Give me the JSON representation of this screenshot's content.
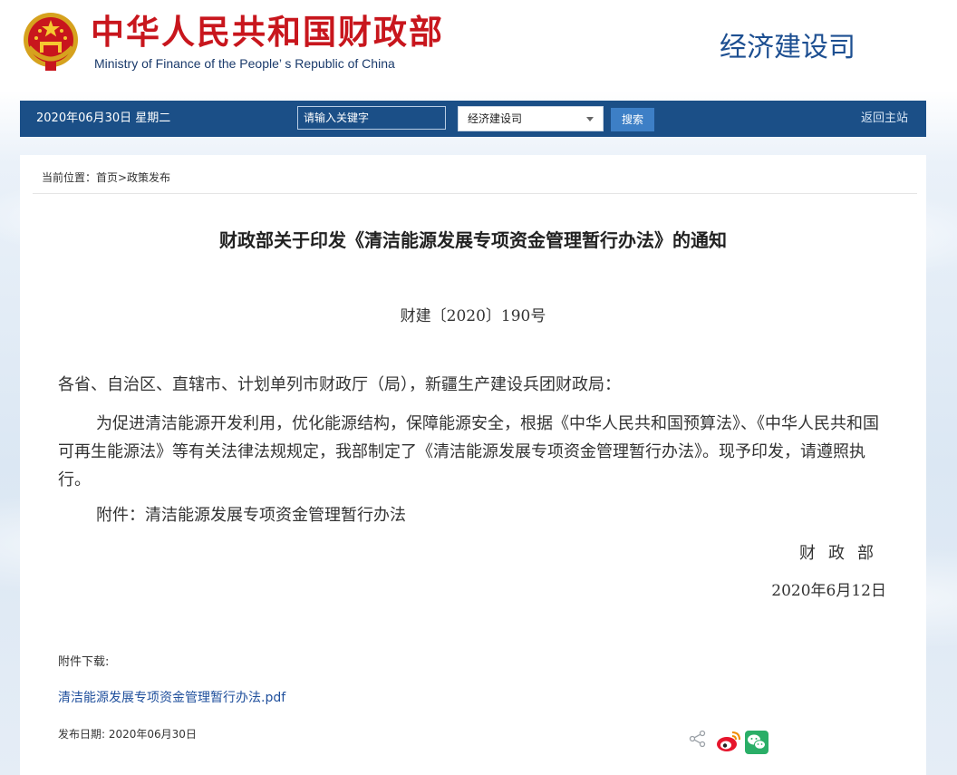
{
  "header": {
    "title_cn": "中华人民共和国财政部",
    "title_en": "Ministry of Finance of the People’ s Republic of China",
    "department": "经济建设司",
    "emblem_icon": "national-emblem-icon"
  },
  "navbar": {
    "date": "2020年06月30日  星期二",
    "search_placeholder": "请输入关键字",
    "select_value": "经济建设司",
    "search_button": "搜索",
    "home_link": "返回主站"
  },
  "breadcrumb": "当前位置：首页>政策发布",
  "article": {
    "title": "财政部关于印发《清洁能源发展专项资金管理暂行办法》的通知",
    "doc_number": "财建〔2020〕190号",
    "addressee": "各省、自治区、直辖市、计划单列市财政厅（局），新疆生产建设兵团财政局：",
    "paragraph": "为促进清洁能源开发利用，优化能源结构，保障能源安全，根据《中华人民共和国预算法》、《中华人民共和国可再生能源法》等有关法律法规规定，我部制定了《清洁能源发展专项资金管理暂行办法》。现予印发，请遵照执行。",
    "attachment_line": "附件：清洁能源发展专项资金管理暂行办法",
    "signature_org": "财政部",
    "signature_date": "2020年6月12日"
  },
  "downloads": {
    "label": "附件下载:",
    "file_link": "清洁能源发展专项资金管理暂行办法.pdf"
  },
  "publish": {
    "date": "发布日期:  2020年06月30日"
  },
  "share_icons": [
    "share-icon",
    "weibo-icon",
    "wechat-icon"
  ],
  "colors": {
    "brand_red": "#c8161d",
    "nav_blue": "#1b4f87",
    "button_blue": "#3d7fc6",
    "link_blue": "#1f4f9c"
  }
}
